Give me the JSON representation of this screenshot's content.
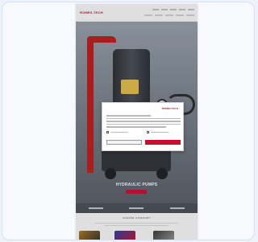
{
  "site": {
    "logo_text": "ROMEX-TECH",
    "brand_color": "#c8102e"
  },
  "hero": {
    "title": "HYDRAULIC PUMPS"
  },
  "section": {
    "title": "CHOOSE CATEGORY"
  },
  "cookie_modal": {
    "logo_text": "ROMEX-TECH",
    "title": "",
    "checkboxes": [
      "",
      ""
    ],
    "decline_label": "",
    "accept_label": ""
  }
}
